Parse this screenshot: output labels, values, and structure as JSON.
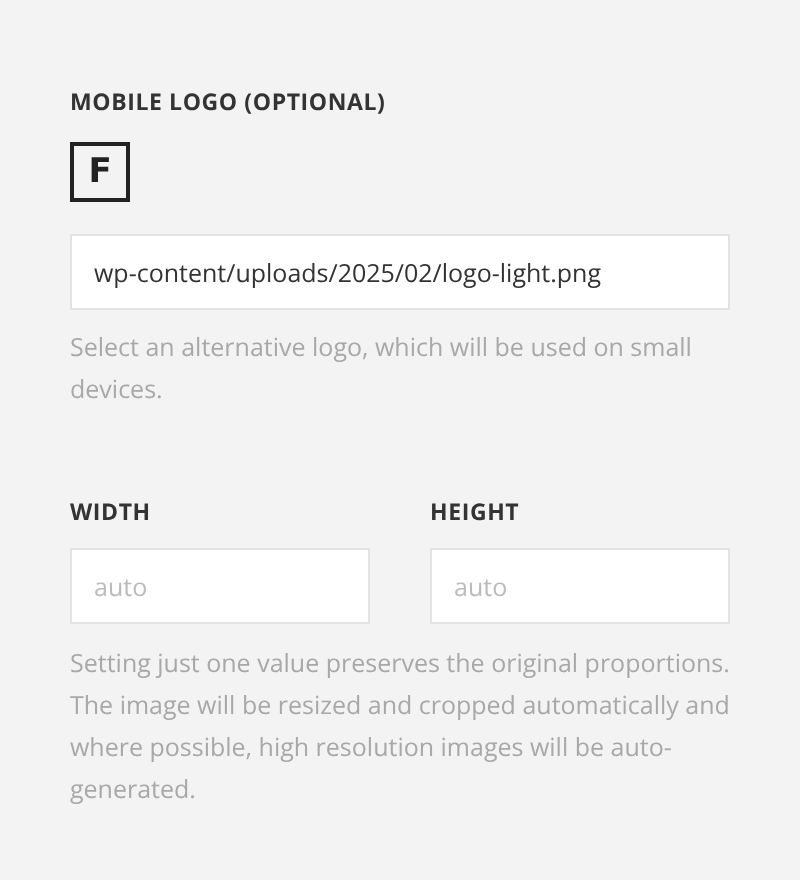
{
  "logo_section": {
    "label": "MOBILE LOGO (OPTIONAL)",
    "logo_letter": "F",
    "url_field": {
      "value": "wp-content/uploads/2025/02/logo-light.png"
    },
    "help": "Select an alternative logo, which will be used on small devices."
  },
  "size_section": {
    "fields": [
      {
        "label": "WIDTH",
        "placeholder": "auto"
      },
      {
        "label": "HEIGHT",
        "placeholder": "auto"
      }
    ],
    "help": "Setting just one value preserves the original proportions. The image will be resized and cropped automatically and where possible, high resolution images will be auto-generated."
  }
}
